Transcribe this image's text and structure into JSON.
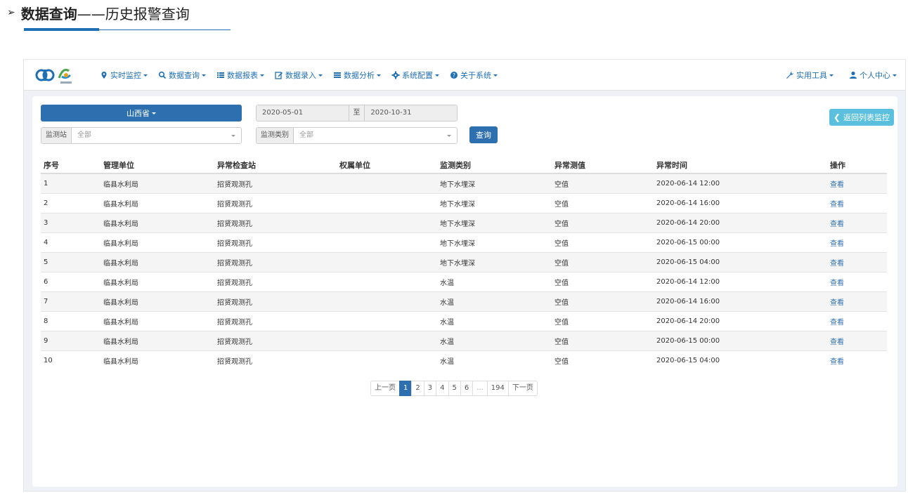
{
  "heading": {
    "main": "数据查询",
    "sub": "——历史报警查询"
  },
  "nav": {
    "left": [
      {
        "label": "实时监控",
        "icon": "map-marker-icon"
      },
      {
        "label": "数据查询",
        "icon": "search-icon"
      },
      {
        "label": "数据报表",
        "icon": "list-icon"
      },
      {
        "label": "数据录入",
        "icon": "edit-icon"
      },
      {
        "label": "数据分析",
        "icon": "tasks-icon"
      },
      {
        "label": "系统配置",
        "icon": "gear-icon"
      },
      {
        "label": "关于系统",
        "icon": "question-circle-icon"
      }
    ],
    "right": [
      {
        "label": "实用工具",
        "icon": "wrench-icon"
      },
      {
        "label": "个人中心",
        "icon": "user-icon"
      }
    ]
  },
  "filters": {
    "province": "山西省",
    "date_from": "2020-05-01",
    "date_to_label": "至",
    "date_to": "2020-10-31",
    "station_label": "监测站",
    "station_value": "全部",
    "type_label": "监测类别",
    "type_value": "全部",
    "query_button": "查询",
    "back_button": "返回列表监控"
  },
  "table": {
    "headers": [
      "序号",
      "管理单位",
      "异常检查站",
      "权属单位",
      "监测类别",
      "异常测值",
      "异常时间",
      "操作"
    ],
    "rows": [
      [
        "1",
        "临县水利局",
        "招贤观测孔",
        "",
        "地下水埋深",
        "空值",
        "2020-06-14 12:00",
        "查看"
      ],
      [
        "2",
        "临县水利局",
        "招贤观测孔",
        "",
        "地下水埋深",
        "空值",
        "2020-06-14 16:00",
        "查看"
      ],
      [
        "3",
        "临县水利局",
        "招贤观测孔",
        "",
        "地下水埋深",
        "空值",
        "2020-06-14 20:00",
        "查看"
      ],
      [
        "4",
        "临县水利局",
        "招贤观测孔",
        "",
        "地下水埋深",
        "空值",
        "2020-06-15 00:00",
        "查看"
      ],
      [
        "5",
        "临县水利局",
        "招贤观测孔",
        "",
        "地下水埋深",
        "空值",
        "2020-06-15 04:00",
        "查看"
      ],
      [
        "6",
        "临县水利局",
        "招贤观测孔",
        "",
        "水温",
        "空值",
        "2020-06-14 12:00",
        "查看"
      ],
      [
        "7",
        "临县水利局",
        "招贤观测孔",
        "",
        "水温",
        "空值",
        "2020-06-14 16:00",
        "查看"
      ],
      [
        "8",
        "临县水利局",
        "招贤观测孔",
        "",
        "水温",
        "空值",
        "2020-06-14 20:00",
        "查看"
      ],
      [
        "9",
        "临县水利局",
        "招贤观测孔",
        "",
        "水温",
        "空值",
        "2020-06-15 00:00",
        "查看"
      ],
      [
        "10",
        "临县水利局",
        "招贤观测孔",
        "",
        "水温",
        "空值",
        "2020-06-15 04:00",
        "查看"
      ]
    ]
  },
  "pagination": {
    "prev": "上一页",
    "pages": [
      "1",
      "2",
      "3",
      "4",
      "5",
      "6",
      "...",
      "194"
    ],
    "active": "1",
    "next": "下一页"
  },
  "colors": {
    "primary": "#2e6fb0",
    "info": "#5bc0de",
    "background": "#eef1f6"
  }
}
